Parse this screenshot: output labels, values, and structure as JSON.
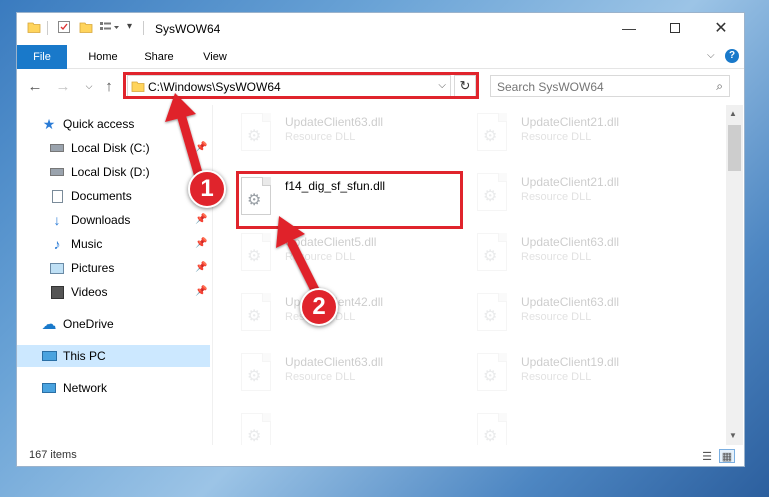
{
  "window": {
    "title": "SysWOW64",
    "controls": {
      "minimize_icon": "minimize-icon",
      "maximize_icon": "maximize-icon",
      "close_icon": "close-icon"
    }
  },
  "ribbon": {
    "tabs": [
      {
        "label": "File",
        "active": true
      },
      {
        "label": "Home"
      },
      {
        "label": "Share"
      },
      {
        "label": "View"
      }
    ]
  },
  "address_bar": {
    "path": "C:\\Windows\\SysWOW64"
  },
  "search": {
    "placeholder": "Search SysWOW64"
  },
  "nav_pane": {
    "items": [
      {
        "label": "Quick access"
      },
      {
        "label": "Local Disk (C:)"
      },
      {
        "label": "Local Disk (D:)"
      },
      {
        "label": "Documents"
      },
      {
        "label": "Downloads"
      },
      {
        "label": "Music"
      },
      {
        "label": "Pictures"
      },
      {
        "label": "Videos"
      },
      {
        "label": "OneDrive"
      },
      {
        "label": "This PC",
        "selected": true
      },
      {
        "label": "Network"
      }
    ]
  },
  "files": [
    {
      "name": "UpdateClient63.dll",
      "type": "Resource DLL"
    },
    {
      "name": "UpdateClient21.dll",
      "type": "Resource DLL"
    },
    {
      "name": "f14_dig_sf_sfun.dll",
      "type": ""
    },
    {
      "name": "UpdateClient21.dll",
      "type": "Resource DLL"
    },
    {
      "name": "UpdateClient5.dll",
      "type": "Resource DLL"
    },
    {
      "name": "UpdateClient63.dll",
      "type": "Resource DLL"
    },
    {
      "name": "UpdateClient42.dll",
      "type": "Resource DLL"
    },
    {
      "name": "UpdateClient63.dll",
      "type": "Resource DLL"
    },
    {
      "name": "UpdateClient63.dll",
      "type": "Resource DLL"
    },
    {
      "name": "UpdateClient19.dll",
      "type": "Resource DLL"
    },
    {
      "name": "",
      "type": ""
    },
    {
      "name": "",
      "type": ""
    }
  ],
  "status": {
    "item_count": "167 items"
  },
  "callouts": [
    {
      "label": "1"
    },
    {
      "label": "2"
    }
  ],
  "colors": {
    "accent": "#1979ca",
    "highlight": "#e0242c",
    "selected": "#cce8ff"
  }
}
